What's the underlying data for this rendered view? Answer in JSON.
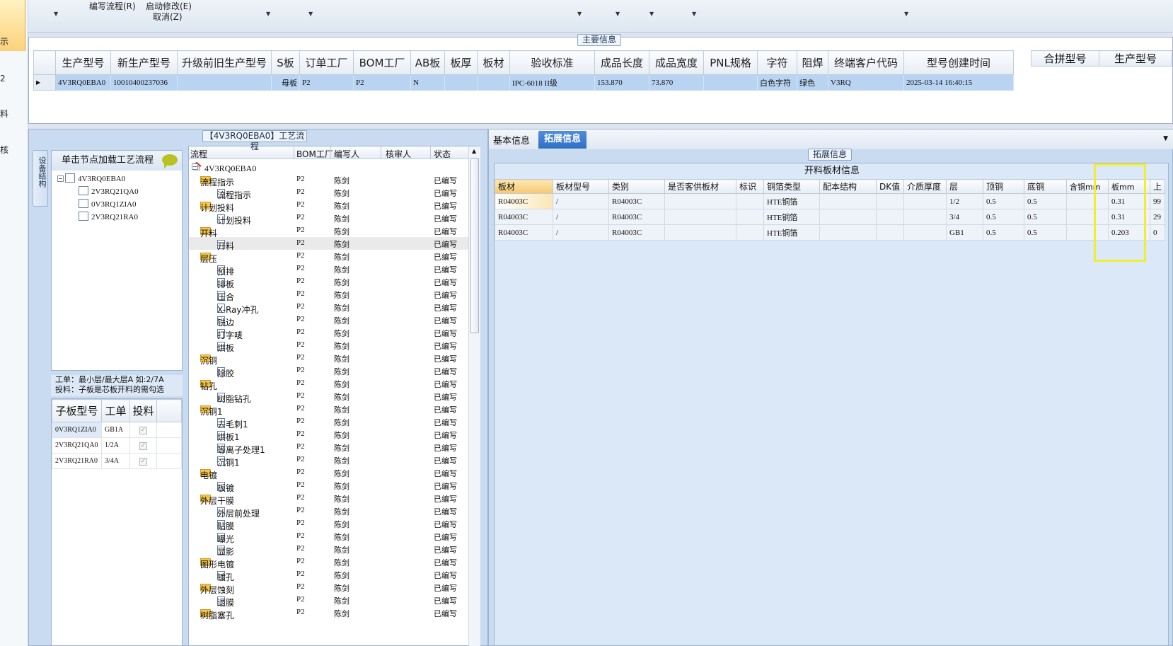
{
  "left_strip": {
    "items": [
      "示",
      "2",
      "料",
      "核"
    ]
  },
  "toolbar": {
    "menu_edit_flow": "编写流程(R)",
    "menu_start_modify": "启动修改(E)",
    "menu_cancel": "取消(Z)"
  },
  "main_info": {
    "title": "主要信息",
    "columns": [
      "生产型号",
      "新生产型号",
      "升级前旧生产型号",
      "S板",
      "订单工厂",
      "BOM工厂",
      "AB板",
      "板厚",
      "板材",
      "验收标准",
      "成品长度",
      "成品宽度",
      "PNL规格",
      "字符",
      "阻焊",
      "终端客户代码",
      "型号创建时间"
    ],
    "row": [
      "4V3RQ0EBA0",
      "10010400237036",
      "",
      "母板",
      "P2",
      "P2",
      "N",
      "",
      "",
      "IPC-6018 II级",
      "153.870",
      "73.870",
      "",
      "白色字符",
      "绿色",
      "V3RQ",
      "2025-03-14 16:40:15"
    ],
    "right_columns": [
      "合拼型号",
      "生产型号"
    ]
  },
  "structure_tab": {
    "label": "设备结构"
  },
  "tree_panel": {
    "header": "单击节点加载工艺流程",
    "root": "4V3RQ0EBA0",
    "children": [
      "2V3RQ21QA0",
      "0V3RQ1ZIA0",
      "2V3RQ21RA0"
    ]
  },
  "note": {
    "line1": "工单：最小层/最大层A 如:2/7A",
    "line2": "投料：子板是芯板开料的需勾选"
  },
  "sub_grid": {
    "columns": [
      "子板型号",
      "工单",
      "投料"
    ],
    "rows": [
      {
        "model": "0V3RQ1ZIA0",
        "order": "GB1A",
        "check": "✓"
      },
      {
        "model": "2V3RQ21QA0",
        "order": "1/2A",
        "check": "✓"
      },
      {
        "model": "2V3RQ21RA0",
        "order": "3/4A",
        "check": "✓"
      }
    ]
  },
  "process": {
    "title": "【4V3RQ0EBA0】工艺流程",
    "columns": [
      "流程",
      "BOM工厂",
      "编写人",
      "核审人",
      "状态"
    ],
    "rows": [
      {
        "name": "4V3RQ0EBA0",
        "bom": "",
        "author": "",
        "status": ""
      },
      {
        "name": "流程指示",
        "bom": "P2",
        "author": "陈剑",
        "status": "已编写"
      },
      {
        "name": "流程指示",
        "bom": "P2",
        "author": "陈剑",
        "status": "已编写"
      },
      {
        "name": "计划投料",
        "bom": "P2",
        "author": "陈剑",
        "status": "已编写"
      },
      {
        "name": "计划投料",
        "bom": "P2",
        "author": "陈剑",
        "status": "已编写"
      },
      {
        "name": "开料",
        "bom": "P2",
        "author": "陈剑",
        "status": "已编写"
      },
      {
        "name": "开料",
        "bom": "P2",
        "author": "陈剑",
        "status": "已编写"
      },
      {
        "name": "层压",
        "bom": "P2",
        "author": "陈剑",
        "status": "已编写"
      },
      {
        "name": "预排",
        "bom": "P2",
        "author": "陈剑",
        "status": "已编写"
      },
      {
        "name": "排板",
        "bom": "P2",
        "author": "陈剑",
        "status": "已编写"
      },
      {
        "name": "压合",
        "bom": "P2",
        "author": "陈剑",
        "status": "已编写"
      },
      {
        "name": "X-Ray冲孔",
        "bom": "P2",
        "author": "陈剑",
        "status": "已编写"
      },
      {
        "name": "铣边",
        "bom": "P2",
        "author": "陈剑",
        "status": "已编写"
      },
      {
        "name": "打字唛",
        "bom": "P2",
        "author": "陈剑",
        "status": "已编写"
      },
      {
        "name": "烘板",
        "bom": "P2",
        "author": "陈剑",
        "status": "已编写"
      },
      {
        "name": "沉铜",
        "bom": "P2",
        "author": "陈剑",
        "status": "已编写"
      },
      {
        "name": "除胶",
        "bom": "P2",
        "author": "陈剑",
        "status": "已编写"
      },
      {
        "name": "钻孔",
        "bom": "P2",
        "author": "陈剑",
        "status": "已编写"
      },
      {
        "name": "树脂钻孔",
        "bom": "P2",
        "author": "陈剑",
        "status": "已编写"
      },
      {
        "name": "沉铜1",
        "bom": "P2",
        "author": "陈剑",
        "status": "已编写"
      },
      {
        "name": "去毛刺1",
        "bom": "P2",
        "author": "陈剑",
        "status": "已编写"
      },
      {
        "name": "烘板1",
        "bom": "P2",
        "author": "陈剑",
        "status": "已编写"
      },
      {
        "name": "等离子处理1",
        "bom": "P2",
        "author": "陈剑",
        "status": "已编写"
      },
      {
        "name": "沉铜1",
        "bom": "P2",
        "author": "陈剑",
        "status": "已编写"
      },
      {
        "name": "电镀",
        "bom": "P2",
        "author": "陈剑",
        "status": "已编写"
      },
      {
        "name": "板镀",
        "bom": "P2",
        "author": "陈剑",
        "status": "已编写"
      },
      {
        "name": "外层干膜",
        "bom": "P2",
        "author": "陈剑",
        "status": "已编写"
      },
      {
        "name": "外层前处理",
        "bom": "P2",
        "author": "陈剑",
        "status": "已编写"
      },
      {
        "name": "贴膜",
        "bom": "P2",
        "author": "陈剑",
        "status": "已编写"
      },
      {
        "name": "曝光",
        "bom": "P2",
        "author": "陈剑",
        "status": "已编写"
      },
      {
        "name": "显影",
        "bom": "P2",
        "author": "陈剑",
        "status": "已编写"
      },
      {
        "name": "图形电镀",
        "bom": "P2",
        "author": "陈剑",
        "status": "已编写"
      },
      {
        "name": "镀孔",
        "bom": "P2",
        "author": "陈剑",
        "status": "已编写"
      },
      {
        "name": "外层蚀刻",
        "bom": "P2",
        "author": "陈剑",
        "status": "已编写"
      },
      {
        "name": "退膜",
        "bom": "P2",
        "author": "陈剑",
        "status": "已编写"
      },
      {
        "name": "树脂塞孔",
        "bom": "P2",
        "author": "陈剑",
        "status": "已编写"
      }
    ]
  },
  "tabs": {
    "basic": "基本信息",
    "extended": "拓展信息"
  },
  "ext_info": {
    "title": "拓展信息",
    "sub_title": "开料板材信息",
    "columns": [
      "板材",
      "板材型号",
      "类别",
      "是否客供板材",
      "标识",
      "铜箔类型",
      "配本结构",
      "DK值",
      "介质厚度",
      "层",
      "顶铜",
      "底铜",
      "含铜mm",
      "板mm",
      "上"
    ],
    "rows": [
      [
        "R04003C",
        "/",
        "R04003C",
        "",
        "",
        "HTE铜箔",
        "",
        "",
        "",
        "1/2",
        "0.5",
        "0.5",
        "",
        "0.31",
        "99"
      ],
      [
        "R04003C",
        "/",
        "R04003C",
        "",
        "",
        "HTE铜箔",
        "",
        "",
        "",
        "3/4",
        "0.5",
        "0.5",
        "",
        "0.31",
        "29"
      ],
      [
        "R04003C",
        "/",
        "R04003C",
        "",
        "",
        "HTE铜箔",
        "",
        "",
        "",
        "GB1",
        "0.5",
        "0.5",
        "",
        "0.203",
        "0"
      ]
    ]
  }
}
